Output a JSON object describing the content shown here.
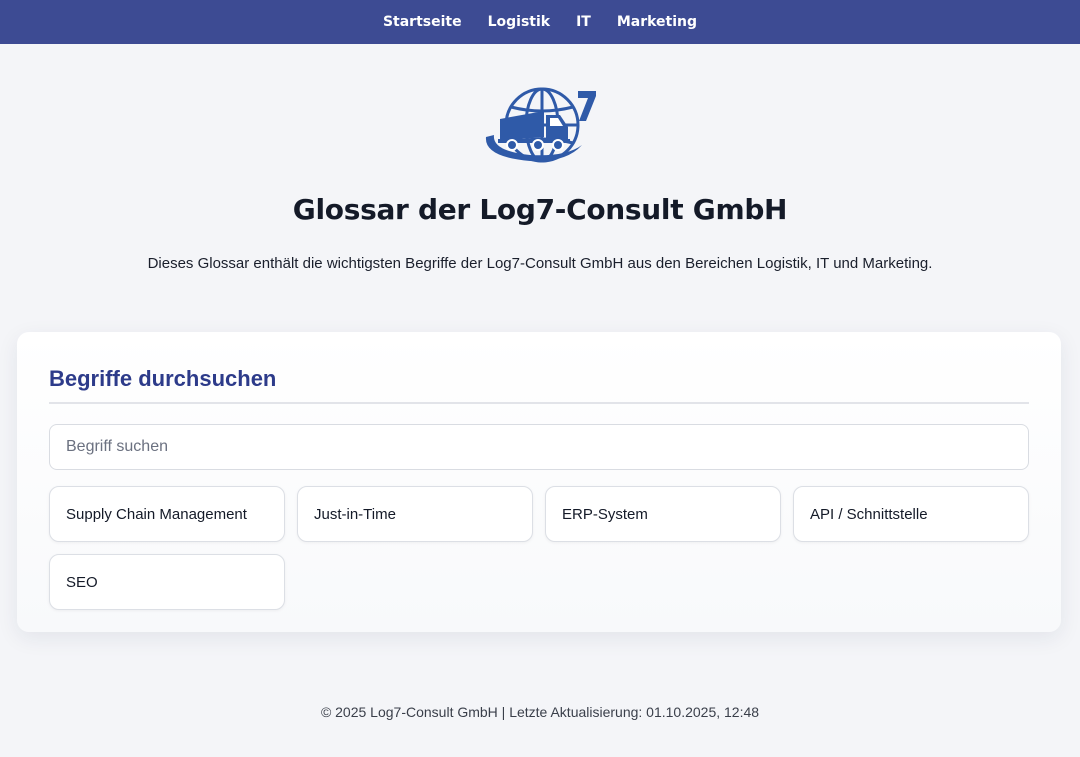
{
  "nav": {
    "items": [
      {
        "label": "Startseite"
      },
      {
        "label": "Logistik"
      },
      {
        "label": "IT"
      },
      {
        "label": "Marketing"
      }
    ]
  },
  "hero": {
    "logo_icon": "globe-truck-logo-icon",
    "title": "Glossar der Log7-Consult GmbH",
    "intro": "Dieses Glossar enthält die wichtigsten Begriffe der Log7-Consult GmbH aus den Bereichen Logistik, IT und Marketing."
  },
  "search": {
    "heading": "Begriffe durchsuchen",
    "placeholder": "Begriff suchen",
    "value": ""
  },
  "terms": [
    {
      "label": "Supply Chain Management"
    },
    {
      "label": "Just-in-Time"
    },
    {
      "label": "ERP-System"
    },
    {
      "label": "API / Schnittstelle"
    },
    {
      "label": "SEO"
    }
  ],
  "footer": {
    "text": "© 2025 Log7-Consult GmbH | Letzte Aktualisierung: 01.10.2025, 12:48"
  },
  "colors": {
    "nav_bg": "#3d4b93",
    "accent": "#2d3b8a",
    "logo": "#2f5aa8",
    "page_bg": "#f4f5f8"
  }
}
